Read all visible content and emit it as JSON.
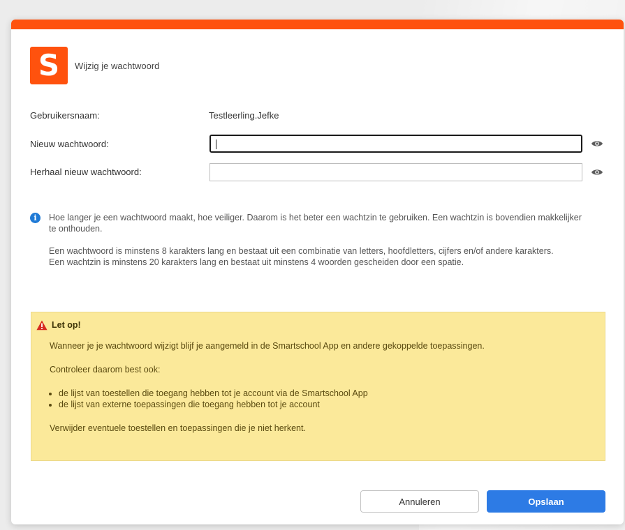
{
  "dialog": {
    "logo_letter": "S",
    "title": "Wijzig je wachtwoord",
    "accent": "#ff520e"
  },
  "form": {
    "username_label": "Gebruikersnaam:",
    "username_value": "Testleerling.Jefke",
    "new_password_label": "Nieuw wachtwoord:",
    "new_password_value": "",
    "repeat_password_label": "Herhaal nieuw wachtwoord:",
    "repeat_password_value": "",
    "show_password_icon": "eye-icon"
  },
  "info": {
    "icon": "info-icon",
    "paragraph1": "Hoe langer je een wachtwoord maakt, hoe veiliger. Daarom is het beter een wachtzin te gebruiken. Een wachtzin is bovendien makkelijker te onthouden.",
    "paragraph2_line1": "Een wachtwoord is minstens 8 karakters lang en bestaat uit een combinatie van letters, hoofdletters, cijfers en/of andere karakters.",
    "paragraph2_line2": "Een wachtzin is minstens 20 karakters lang en bestaat uit minstens 4 woorden gescheiden door een spatie."
  },
  "warning": {
    "icon": "warning-icon",
    "heading": "Let op!",
    "text1": "Wanneer je je wachtwoord wijzigt blijf je aangemeld in de Smartschool App en andere gekoppelde toepassingen.",
    "text2": "Controleer daarom best ook:",
    "items": [
      "de lijst van toestellen die toegang hebben tot je account via de Smartschool App",
      "de lijst van externe toepassingen die toegang hebben tot je account"
    ],
    "text3": "Verwijder eventuele toestellen en toepassingen die je niet herkent.",
    "background": "#fbe99a"
  },
  "buttons": {
    "cancel_label": "Annuleren",
    "save_label": "Opslaan",
    "save_color": "#2d7be5"
  }
}
